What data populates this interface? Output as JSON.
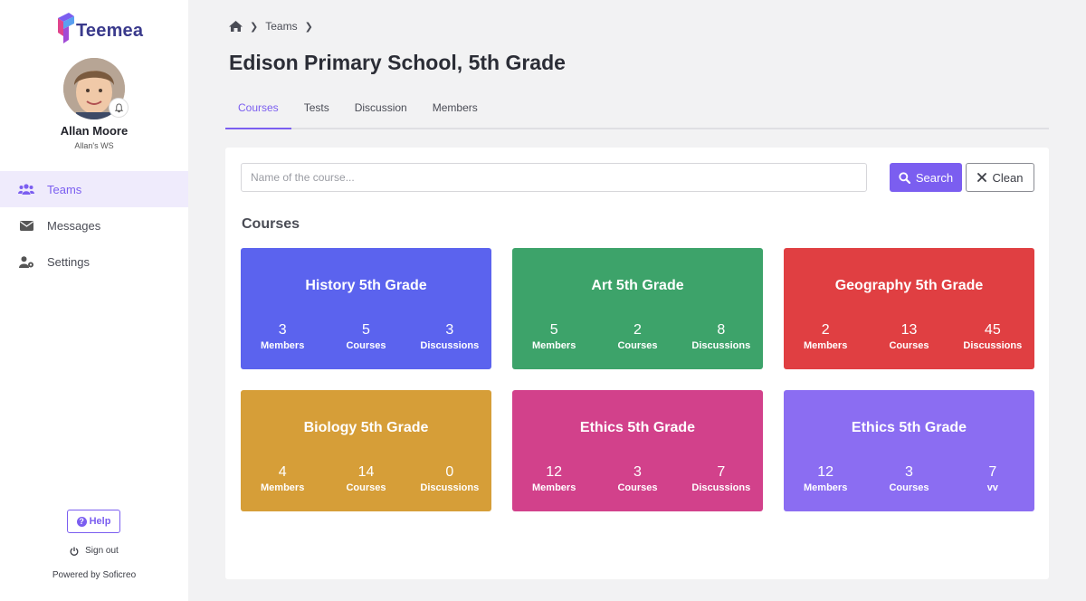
{
  "app": {
    "name": "Teemea"
  },
  "user": {
    "name": "Allan Moore",
    "workspace": "Allan's WS"
  },
  "sidebar": {
    "items": [
      {
        "label": "Teams",
        "icon": "users-icon",
        "active": true
      },
      {
        "label": "Messages",
        "icon": "envelope-icon",
        "active": false
      },
      {
        "label": "Settings",
        "icon": "user-gear-icon",
        "active": false
      }
    ],
    "help_label": "Help",
    "signout_label": "Sign out",
    "powered_by": "Powered by Soficreo"
  },
  "breadcrumb": {
    "home_icon": "home-icon",
    "items": [
      "Teams"
    ]
  },
  "page": {
    "title": "Edison Primary School, 5th Grade"
  },
  "tabs": [
    {
      "label": "Courses",
      "active": true
    },
    {
      "label": "Tests",
      "active": false
    },
    {
      "label": "Discussion",
      "active": false
    },
    {
      "label": "Members",
      "active": false
    }
  ],
  "search": {
    "placeholder": "Name of the course...",
    "value": "",
    "search_label": "Search",
    "clean_label": "Clean"
  },
  "courses_section": {
    "title": "Courses"
  },
  "colors": {
    "accent": "#7b5ef0"
  },
  "courses": [
    {
      "title": "History 5th Grade",
      "color": "#5b63ee",
      "stats": [
        {
          "value": "3",
          "label": "Members"
        },
        {
          "value": "5",
          "label": "Courses"
        },
        {
          "value": "3",
          "label": "Discussions"
        }
      ]
    },
    {
      "title": "Art 5th Grade",
      "color": "#3da36a",
      "stats": [
        {
          "value": "5",
          "label": "Members"
        },
        {
          "value": "2",
          "label": "Courses"
        },
        {
          "value": "8",
          "label": "Discussions"
        }
      ]
    },
    {
      "title": "Geography 5th Grade",
      "color": "#e03f42",
      "stats": [
        {
          "value": "2",
          "label": "Members"
        },
        {
          "value": "13",
          "label": "Courses"
        },
        {
          "value": "45",
          "label": "Discussions"
        }
      ]
    },
    {
      "title": "Biology 5th Grade",
      "color": "#d69e38",
      "stats": [
        {
          "value": "4",
          "label": "Members"
        },
        {
          "value": "14",
          "label": "Courses"
        },
        {
          "value": "0",
          "label": "Discussions"
        }
      ]
    },
    {
      "title": "Ethics 5th Grade",
      "color": "#d2418b",
      "stats": [
        {
          "value": "12",
          "label": "Members"
        },
        {
          "value": "3",
          "label": "Courses"
        },
        {
          "value": "7",
          "label": "Discussions"
        }
      ]
    },
    {
      "title": "Ethics 5th Grade",
      "color": "#8b6df2",
      "stats": [
        {
          "value": "12",
          "label": "Members"
        },
        {
          "value": "3",
          "label": "Courses"
        },
        {
          "value": "7",
          "label": "vv"
        }
      ]
    }
  ]
}
